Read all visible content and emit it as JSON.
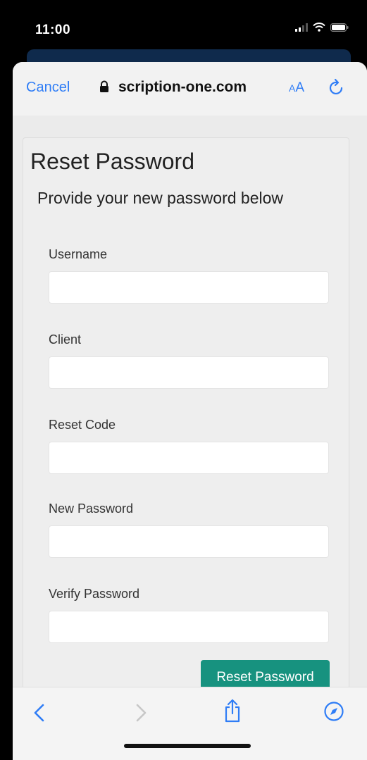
{
  "status_bar": {
    "time": "11:00"
  },
  "browser": {
    "cancel_label": "Cancel",
    "url": "scription-one.com",
    "text_size_small": "A",
    "text_size_large": "A"
  },
  "page": {
    "title": "Reset Password",
    "subtitle": "Provide your new password below",
    "fields": [
      {
        "label": "Username",
        "value": "",
        "placeholder": ""
      },
      {
        "label": "Client",
        "value": "",
        "placeholder": ""
      },
      {
        "label": "Reset Code",
        "value": "",
        "placeholder": ""
      },
      {
        "label": "New Password",
        "value": "",
        "placeholder": ""
      },
      {
        "label": "Verify Password",
        "value": "",
        "placeholder": ""
      }
    ],
    "submit_label": "Reset Password"
  },
  "icons": {
    "lock": "lock-icon",
    "refresh": "refresh-icon",
    "back": "chevron-left-icon",
    "forward": "chevron-right-icon",
    "share": "share-icon",
    "compass": "compass-icon"
  },
  "colors": {
    "accent": "#2f7df6",
    "button": "#17927f",
    "status_background": "#000000"
  }
}
